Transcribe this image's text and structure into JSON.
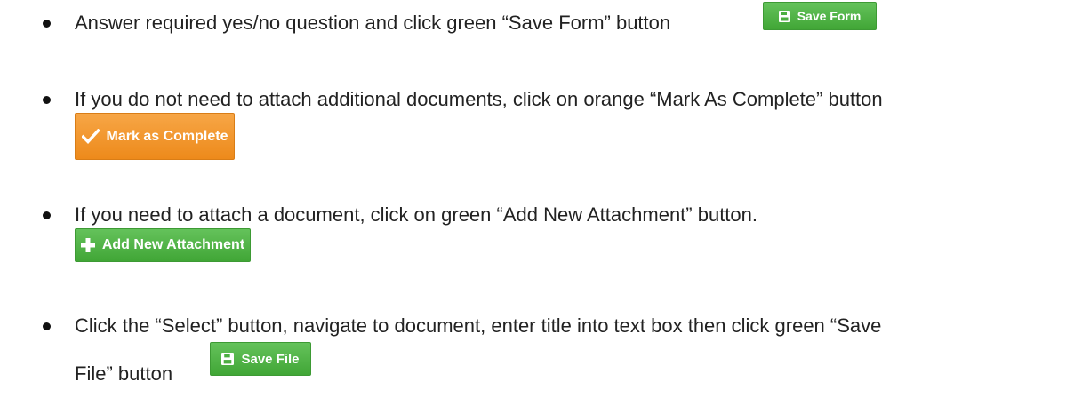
{
  "steps": [
    {
      "text": "Answer required yes/no question and click green “Save Form” button",
      "button": {
        "label": "Save Form",
        "icon": "floppy-disk-icon",
        "color": "#4cae41"
      }
    },
    {
      "text": "If you do not need to attach additional documents, click on orange “Mark As Complete” button",
      "button": {
        "label": "Mark as Complete",
        "icon": "checkmark-icon",
        "color": "#f19430"
      }
    },
    {
      "text": "If you need to attach a document, click on green “Add New Attachment” button.",
      "button": {
        "label": "Add New Attachment",
        "icon": "plus-icon",
        "color": "#4cae41"
      }
    },
    {
      "text_line1": "Click the “Select” button, navigate to document, enter title into text box then click green “Save",
      "text_line2": "File” button",
      "button": {
        "label": "Save File",
        "icon": "floppy-disk-icon",
        "color": "#4cae41"
      }
    }
  ]
}
